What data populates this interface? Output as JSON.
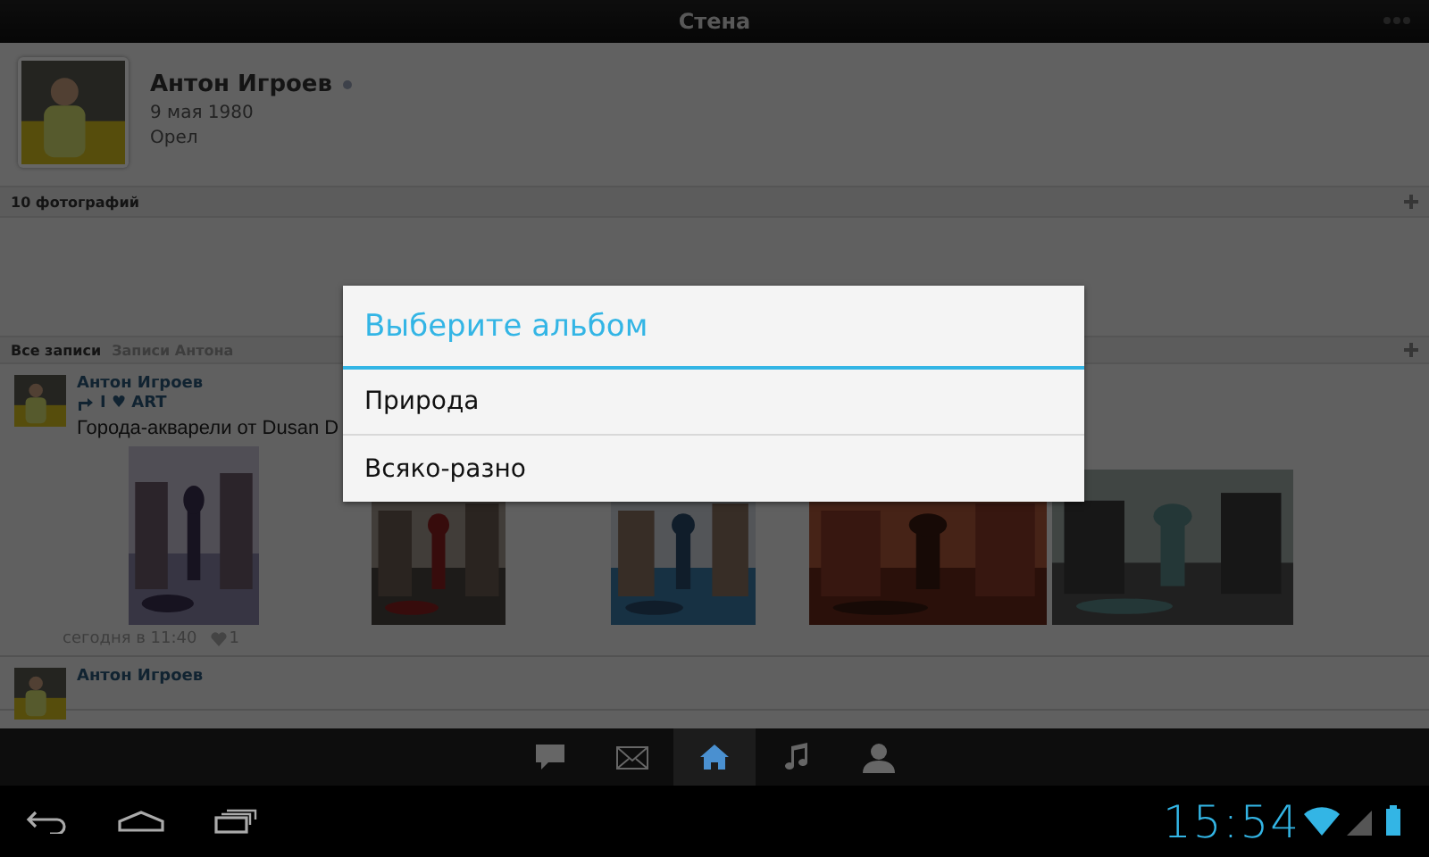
{
  "action_bar": {
    "title": "Стена"
  },
  "profile": {
    "name": "Антон Игроев",
    "online": true,
    "birthday": "9 мая 1980",
    "city": "Орел"
  },
  "photos_header": {
    "label": "10 фотографий"
  },
  "wall_tabs": [
    {
      "label": "Все записи",
      "selected": true
    },
    {
      "label": "Записи Антона",
      "selected": false
    }
  ],
  "posts": [
    {
      "author": "Антон Игроев",
      "source": "I ♥ ART",
      "text": "Города-акварели от Dusan D",
      "time": "сегодня в 11:40",
      "likes": "1"
    },
    {
      "author": "Антон Игроев"
    }
  ],
  "bottom_nav": [
    {
      "kind": "chat",
      "selected": false
    },
    {
      "kind": "mail",
      "selected": false
    },
    {
      "kind": "home",
      "selected": true
    },
    {
      "kind": "music",
      "selected": false
    },
    {
      "kind": "person",
      "selected": false
    }
  ],
  "dialog": {
    "title": "Выберите альбом",
    "options": [
      "Природа",
      "Всяко-разно"
    ]
  },
  "system_bar": {
    "time": "15:54"
  }
}
